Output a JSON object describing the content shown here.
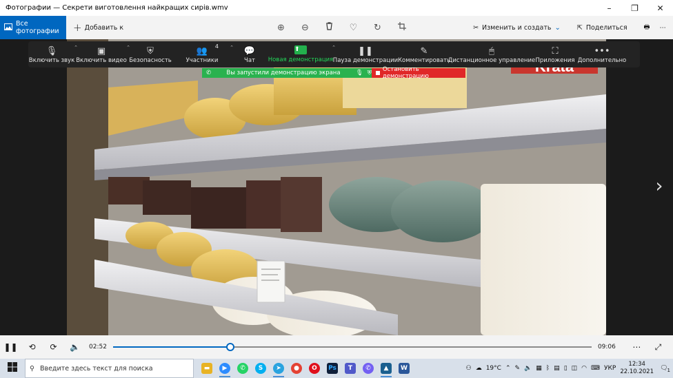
{
  "window": {
    "title": "Фотографии — Секрети виготовлення найкращих сирів.wmv",
    "controls": {
      "minimize": "–",
      "restore": "❐",
      "close": "✕"
    }
  },
  "toolbar": {
    "all_photos": "Все фотографии",
    "add": "Добавить к",
    "edit_create": "Изменить и создать",
    "share": "Поделиться"
  },
  "zoom": {
    "items": [
      {
        "label": "Включить звук",
        "icon": "mic-muted-icon"
      },
      {
        "label": "Включить видео",
        "icon": "video-off-icon"
      },
      {
        "label": "Безопасность",
        "icon": "shield-icon"
      },
      {
        "label": "Участники",
        "icon": "participants-icon",
        "count": "4"
      },
      {
        "label": "Чат",
        "icon": "chat-icon"
      },
      {
        "label": "Новая демонстрация",
        "icon": "share-screen-icon"
      },
      {
        "label": "Пауза демонстрации",
        "icon": "pause-icon"
      },
      {
        "label": "Комментировать",
        "icon": "pen-icon"
      },
      {
        "label": "Дистанционное управление",
        "icon": "mouse-icon"
      },
      {
        "label": "Приложения",
        "icon": "apps-icon"
      },
      {
        "label": "Дополнительно",
        "icon": "more-icon"
      }
    ],
    "sharing_text": "Вы запустили демонстрацию экрана",
    "stop_text": "Остановить демонстрацию"
  },
  "photo": {
    "watermark": "Krata"
  },
  "media": {
    "current_time": "02:52",
    "total_time": "09:06",
    "progress": 0.245
  },
  "taskbar": {
    "search_placeholder": "Введите здесь текст для поиска",
    "weather": "19°C",
    "language": "УКР",
    "time": "12:34",
    "date": "22.10.2021",
    "notifications": "1"
  }
}
